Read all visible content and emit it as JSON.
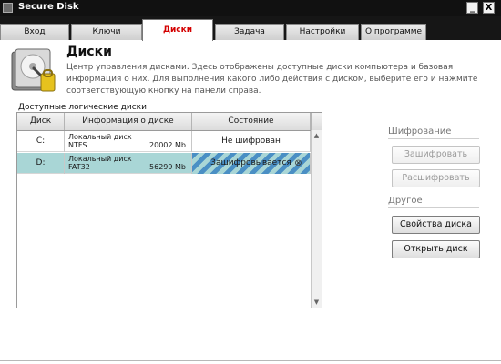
{
  "window": {
    "title": "Secure Disk",
    "minimize_glyph": "_",
    "close_glyph": "X"
  },
  "tabs": [
    {
      "label": "Вход"
    },
    {
      "label": "Ключи"
    },
    {
      "label": "Диски",
      "active": true
    },
    {
      "label": "Задача"
    },
    {
      "label": "Настройки"
    },
    {
      "label": "О программе"
    }
  ],
  "header": {
    "title": "Диски",
    "description": "Центр управления дисками. Здесь отображены доступные диски компьютера и базовая информация о них. Для выполнения какого либо действия с диском, выберите его и нажмите соответствующую кнопку на панели справа.",
    "icon": "disk-drive-icon"
  },
  "disks_panel": {
    "label": "Доступные логические диски:",
    "columns": [
      "Диск",
      "Информация о диске",
      "Состояние"
    ],
    "rows": [
      {
        "letter": "C:",
        "name": "Локальный диск",
        "fs": "NTFS",
        "size": "20002 Mb",
        "state": "Не шифрован",
        "selected": false
      },
      {
        "letter": "D:",
        "name": "Локальный диск",
        "fs": "FAT32",
        "size": "56299 Mb",
        "state": "Зашифровывается",
        "selected": true
      }
    ]
  },
  "actions": {
    "encryption_label": "Шифрование",
    "encrypt_button": "Зашифровать",
    "decrypt_button": "Расшифровать",
    "other_label": "Другое",
    "properties_button": "Свойства диска",
    "open_button": "Открыть диск"
  },
  "colors": {
    "titlebar": "#111111",
    "active_tab_text": "#d40000",
    "selected_row": "#a9d6d6",
    "progress_stripe": "#4a8fc4"
  }
}
